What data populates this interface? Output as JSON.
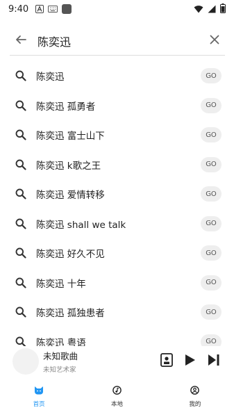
{
  "status_bar": {
    "time": "9:40",
    "icons": [
      "font-icon",
      "keyboard-icon",
      "app-square-icon",
      "wifi-icon",
      "cellular-icon",
      "battery-icon"
    ]
  },
  "search": {
    "query": "陈奕迅",
    "placeholder": ""
  },
  "suggestions": [
    {
      "text": "陈奕迅",
      "go": "GO"
    },
    {
      "text": "陈奕迅 孤勇者",
      "go": "GO"
    },
    {
      "text": "陈奕迅 富士山下",
      "go": "GO"
    },
    {
      "text": "陈奕迅 k歌之王",
      "go": "GO"
    },
    {
      "text": "陈奕迅 爱情转移",
      "go": "GO"
    },
    {
      "text": "陈奕迅 shall we talk",
      "go": "GO"
    },
    {
      "text": "陈奕迅 好久不见",
      "go": "GO"
    },
    {
      "text": "陈奕迅 十年",
      "go": "GO"
    },
    {
      "text": "陈奕迅 孤独患者",
      "go": "GO"
    },
    {
      "text": "陈奕迅 粤语",
      "go": "GO"
    }
  ],
  "player": {
    "title": "未知歌曲",
    "artist": "未知艺术家"
  },
  "nav": [
    {
      "label": "首页",
      "icon": "cat-face-icon",
      "active": true
    },
    {
      "label": "本地",
      "icon": "music-note-icon",
      "active": false
    },
    {
      "label": "我的",
      "icon": "profile-icon",
      "active": false
    }
  ],
  "colors": {
    "accent": "#2196f3",
    "go_bg": "#eeeeee"
  }
}
